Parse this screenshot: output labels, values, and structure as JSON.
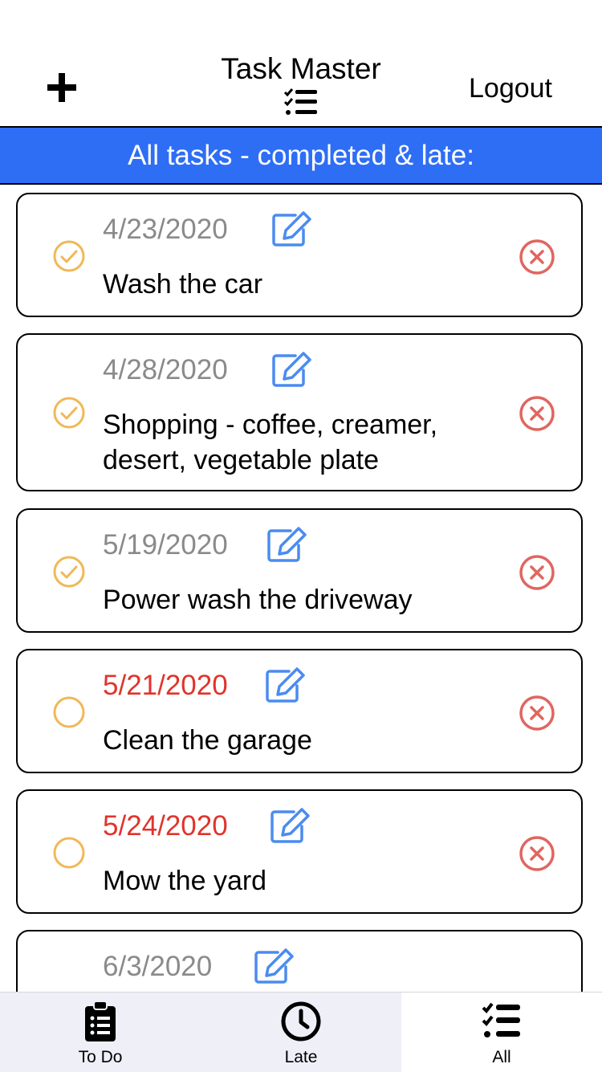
{
  "header": {
    "title": "Task Master",
    "logout_label": "Logout",
    "add_icon": "plus-icon",
    "title_icon": "checklist-icon"
  },
  "banner": {
    "text": "All tasks - completed & late:",
    "color": "#2e6ef5"
  },
  "colors": {
    "check": "#f0b857",
    "edit": "#4a8cf0",
    "delete": "#e06660",
    "late_date": "#e0342c",
    "normal_date": "#8a8a8a"
  },
  "tasks": [
    {
      "date": "4/23/2020",
      "text": "Wash the car",
      "completed": true,
      "late": false
    },
    {
      "date": "4/28/2020",
      "text": "Shopping - coffee, creamer, desert, vegetable plate",
      "completed": true,
      "late": false
    },
    {
      "date": "5/19/2020",
      "text": "Power wash the driveway",
      "completed": true,
      "late": false
    },
    {
      "date": "5/21/2020",
      "text": "Clean the garage",
      "completed": false,
      "late": true
    },
    {
      "date": "5/24/2020",
      "text": "Mow the yard",
      "completed": false,
      "late": true
    },
    {
      "date": "6/3/2020",
      "text": "",
      "completed": false,
      "late": false
    }
  ],
  "tabs": [
    {
      "label": "To Do",
      "icon": "clipboard-list-icon",
      "selected": false
    },
    {
      "label": "Late",
      "icon": "clock-icon",
      "selected": false
    },
    {
      "label": "All",
      "icon": "checklist-icon",
      "selected": true
    }
  ]
}
